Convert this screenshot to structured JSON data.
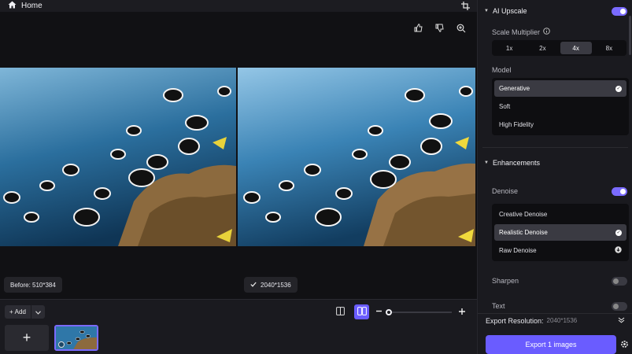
{
  "topbar": {
    "home_label": "Home"
  },
  "viewer": {
    "before_label": "Before: 510*384",
    "after_label": "2040*1536"
  },
  "bottom": {
    "add_label": "Add",
    "add_thumb_symbol": "+"
  },
  "side": {
    "ai_upscale": {
      "title": "AI Upscale",
      "enabled": true
    },
    "scale_multiplier": {
      "label": "Scale Multiplier",
      "options": [
        "1x",
        "2x",
        "4x",
        "8x"
      ],
      "selected": "4x"
    },
    "model": {
      "label": "Model",
      "options": [
        "Generative",
        "Soft",
        "High Fidelity"
      ],
      "selected": "Generative"
    },
    "enhancements": {
      "title": "Enhancements"
    },
    "denoise": {
      "label": "Denoise",
      "enabled": true,
      "options": [
        "Creative Denoise",
        "Realistic Denoise",
        "Raw Denoise"
      ],
      "selected": "Realistic Denoise"
    },
    "sharpen": {
      "label": "Sharpen",
      "enabled": false
    },
    "text": {
      "label": "Text",
      "enabled": false
    },
    "export": {
      "resolution_label": "Export Resolution:",
      "resolution_value": "2040*1536",
      "button_label": "Export 1 images"
    }
  },
  "colors": {
    "accent": "#6a5cff",
    "panel": "#1a1a1f",
    "viewer_bg": "#111114"
  }
}
